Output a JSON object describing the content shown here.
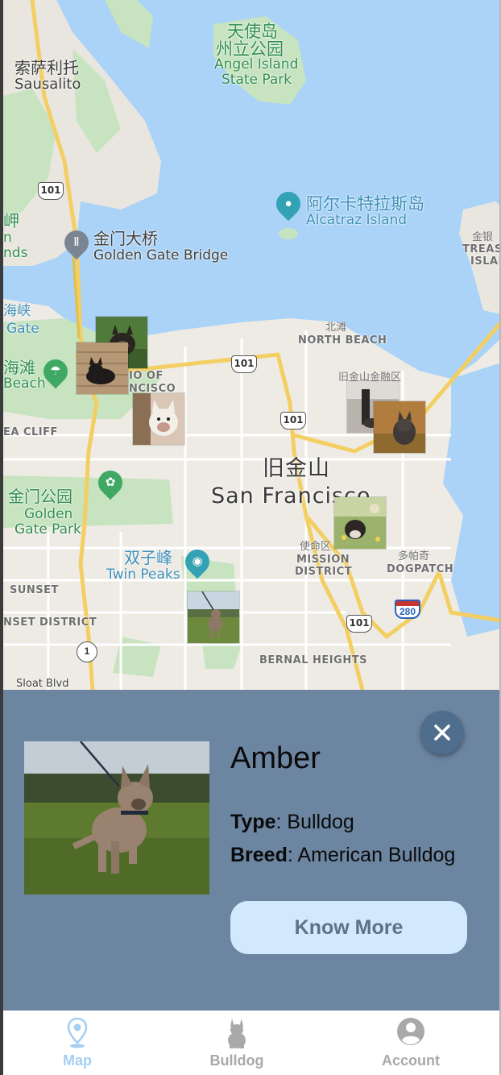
{
  "map": {
    "labels": {
      "angel_island_cn": "天使岛",
      "angel_island_cn2": "州立公园",
      "angel_island_en": "Angel Island",
      "angel_island_en2": "State Park",
      "sausalito_cn": "索萨利托",
      "sausalito_en": "Sausalito",
      "alcatraz_cn": "阿尔卡特拉斯岛",
      "alcatraz_en": "Alcatraz Island",
      "golden_gate_bridge_cn": "金门大桥",
      "golden_gate_bridge_en": "Golden Gate Bridge",
      "headlands_cn": "岬",
      "headlands_en1": "n",
      "headlands_en2": "nds",
      "strait_cn": "海峡",
      "strait_en": "Gate",
      "beach_cn": "海滩",
      "beach_en": "Beach",
      "presidio_partial1": "IO OF",
      "presidio_partial2": "NCISCO",
      "north_beach_cn": "北滩",
      "north_beach_en": "NORTH BEACH",
      "financial_cn": "旧金山金融区",
      "sea_cliff": "EA CLIFF",
      "sf_cn": "旧金山",
      "sf_en": "San Francisco",
      "ggpark_cn": "金门公园",
      "ggpark_en1": "Golden",
      "ggpark_en2": "Gate Park",
      "twin_peaks_cn": "双子峰",
      "twin_peaks_en": "Twin Peaks",
      "mission_cn": "使命区",
      "mission_en1": "MISSION",
      "mission_en2": "DISTRICT",
      "dogpatch_cn": "多帕奇",
      "dogpatch_en": "DOGPATCH",
      "sunset": "SUNSET",
      "sunset_district": "NSET DISTRICT",
      "bernal_heights": "BERNAL HEIGHTS",
      "sloat": "Sloat Blvd",
      "treasure_cn": "金银",
      "treasure_en1": "TREAS",
      "treasure_en2": "ISLAN"
    },
    "shields": {
      "hwy101_a": "101",
      "hwy101_b": "101",
      "hwy101_c": "101",
      "hwy101_d": "101",
      "hwy1": "1",
      "i280": "280"
    },
    "dog_markers": [
      {
        "name": "dog-marker-1"
      },
      {
        "name": "dog-marker-2"
      },
      {
        "name": "dog-marker-3"
      },
      {
        "name": "dog-marker-4"
      },
      {
        "name": "dog-marker-5"
      },
      {
        "name": "dog-marker-6"
      },
      {
        "name": "dog-marker-7"
      }
    ]
  },
  "card": {
    "name": "Amber",
    "type_label": "Type",
    "type_value": "Bulldog",
    "breed_label": "Breed",
    "breed_value": "American Bulldog",
    "know_more_label": "Know More",
    "close_icon": "close-icon"
  },
  "tabs": [
    {
      "label": "Map",
      "icon": "map-pin-icon",
      "active": true
    },
    {
      "label": "Bulldog",
      "icon": "bulldog-icon",
      "active": false
    },
    {
      "label": "Account",
      "icon": "account-icon",
      "active": false
    }
  ],
  "colors": {
    "card_bg": "#6c85a1",
    "button_bg": "#d2e8fc",
    "active_tab": "#a4cef4",
    "inactive_tab": "#a9a9a9",
    "water": "#abd3f7"
  }
}
